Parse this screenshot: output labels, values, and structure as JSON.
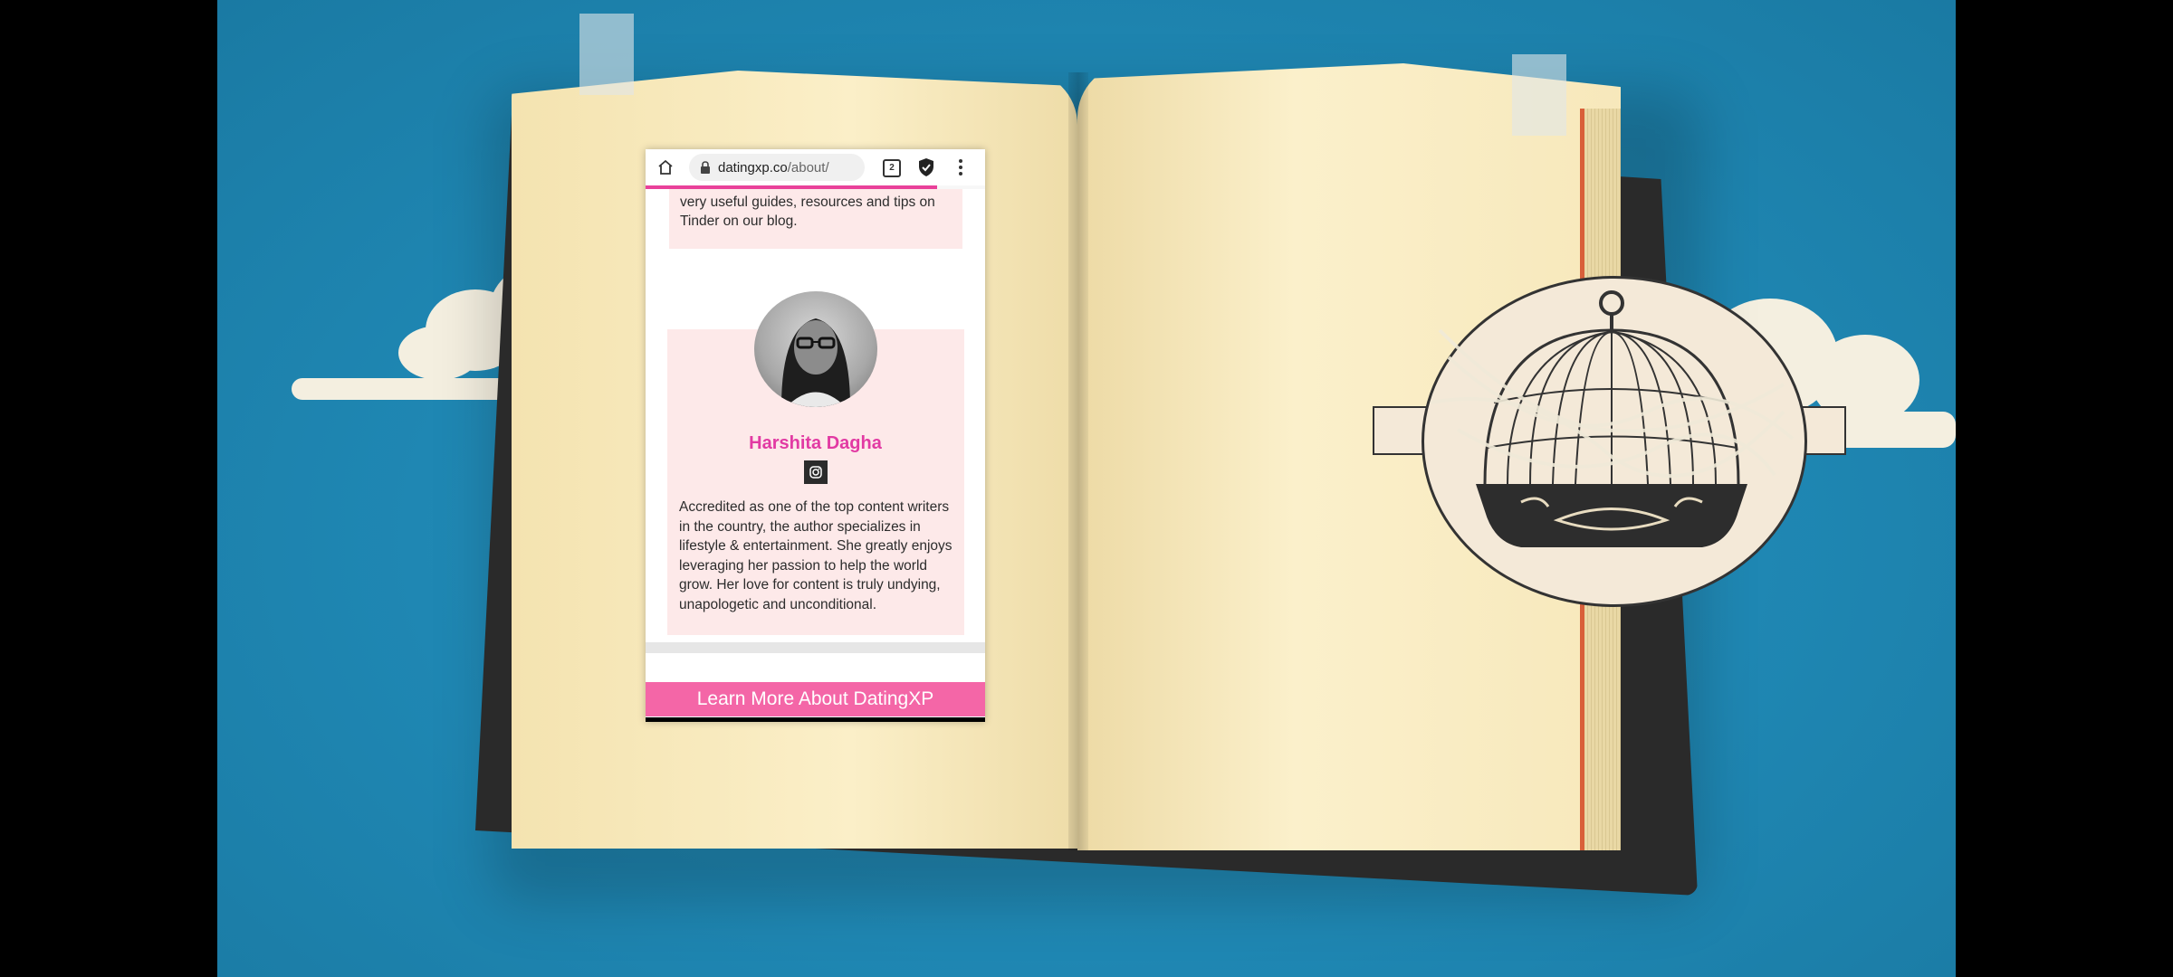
{
  "browser": {
    "url_domain": "datingxp.co",
    "url_path": "/about/",
    "tab_count": "2"
  },
  "page": {
    "intro_snippet": "very useful guides, resources and tips on Tinder on our blog.",
    "author": {
      "name": "Harshita Dagha",
      "bio": "Accredited as one of the top content writers in the country, the author specializes in lifestyle & entertainment. She greatly enjoys leveraging her passion to help the world grow. Her love for content is truly undying, unapologetic and unconditional."
    },
    "cta_label": "Learn More About DatingXP"
  },
  "colors": {
    "accent_pink": "#e23aa3",
    "cta_pink": "#f466a7",
    "card_bg": "#fde9e9"
  },
  "icons": [
    "home-icon",
    "lock-icon",
    "tabs-count-icon",
    "shield-icon",
    "more-menu-icon",
    "instagram-icon"
  ]
}
